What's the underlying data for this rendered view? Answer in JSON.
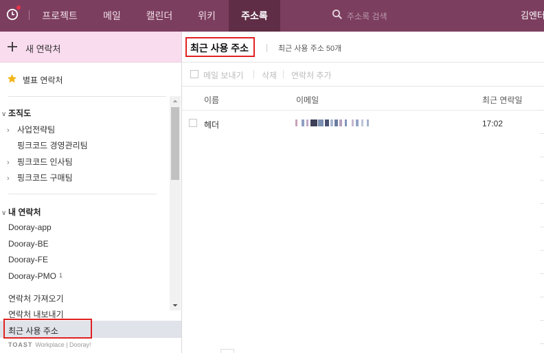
{
  "nav": {
    "tabs": [
      {
        "label": "프로젝트"
      },
      {
        "label": "메일"
      },
      {
        "label": "캘린더"
      },
      {
        "label": "위키"
      },
      {
        "label": "주소록",
        "active": true
      }
    ],
    "search_placeholder": "주소록 검색",
    "user_name": "김엔터",
    "accent_color": "#7c3e5f",
    "active_tab_color": "#5f2d46",
    "notification_dot_color": "#e8334a"
  },
  "sidebar": {
    "new_contact_label": "새 연락처",
    "favorites_label": "별표 연락처",
    "org_chart": {
      "heading": "조직도",
      "items": [
        {
          "label": "사업전략팀",
          "expandable": true
        },
        {
          "label": "핑크코드 경영관리팀",
          "expandable": false
        },
        {
          "label": "핑크코드 인사팀",
          "expandable": true
        },
        {
          "label": "핑크코드 구매팀",
          "expandable": true
        }
      ]
    },
    "my_contacts": {
      "heading": "내 연락처",
      "items": [
        {
          "label": "Dooray-app"
        },
        {
          "label": "Dooray-BE"
        },
        {
          "label": "Dooray-FE"
        },
        {
          "label": "Dooray-PMO",
          "count": "1"
        }
      ]
    },
    "import_label": "연락처 가져오기",
    "export_label": "연락처 내보내기",
    "recent_label": "최근 사용 주소",
    "footer_brand": "TOAST",
    "footer_text": "Workplace | Dooray!"
  },
  "main": {
    "title": "최근 사용 주소",
    "subtitle": "최근 사용 주소 50개",
    "toolbar": {
      "send_mail": "메일 보내기",
      "delete": "삭제",
      "add_contact": "연락처 추가"
    },
    "columns": {
      "name": "이름",
      "email": "이메일",
      "last_contact": "최근 연락일"
    },
    "rows": [
      {
        "name": "헤더",
        "email": "[redacted]",
        "last_contact": "17:02"
      }
    ],
    "highlight_color": "#e02020"
  }
}
